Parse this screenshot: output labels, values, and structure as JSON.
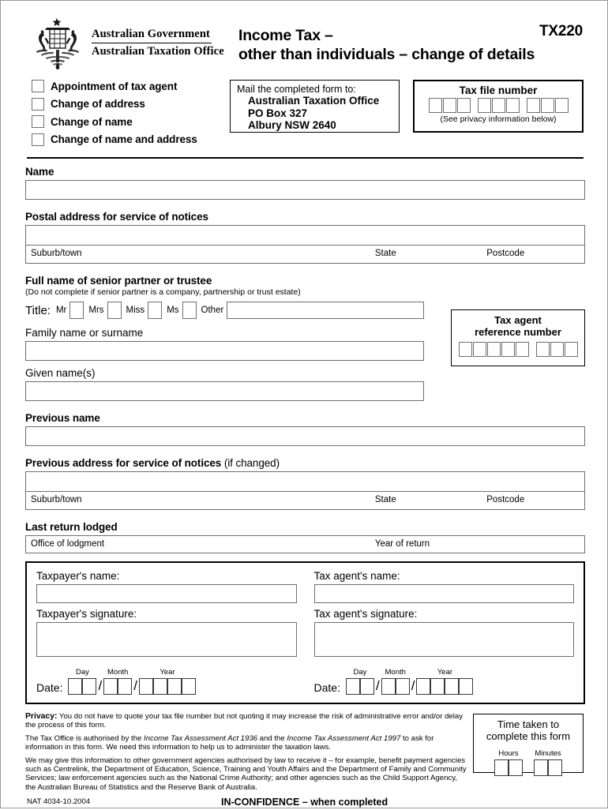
{
  "header": {
    "crest_icon": "australian-coat-of-arms-icon",
    "gov_line1": "Australian Government",
    "gov_line2": "Australian Taxation Office",
    "title_line1": "Income Tax –",
    "title_line2": "other than individuals – change of details",
    "form_code": "TX220"
  },
  "options": [
    {
      "label": "Appointment of tax agent"
    },
    {
      "label": "Change of address"
    },
    {
      "label": "Change of name"
    },
    {
      "label": "Change of name and address"
    }
  ],
  "mail_box": {
    "intro": "Mail the completed form to:",
    "line1": "Australian Taxation Office",
    "line2": "PO Box 327",
    "line3": "Albury NSW 2640"
  },
  "tfn_box": {
    "title": "Tax file number",
    "note": "(See privacy information below)",
    "groups": [
      3,
      3,
      3
    ]
  },
  "name_section": {
    "heading": "Name",
    "value": ""
  },
  "postal_address": {
    "heading": "Postal address for service of notices",
    "line1_value": "",
    "suburb_label": "Suburb/town",
    "state_label": "State",
    "postcode_label": "Postcode"
  },
  "senior_partner": {
    "heading": "Full name of senior partner or trustee",
    "subheading": "(Do not complete if senior partner is a company, partnership or trust estate)",
    "title_label": "Title:",
    "titles": [
      "Mr",
      "Mrs",
      "Miss",
      "Ms"
    ],
    "other_label": "Other",
    "other_value": "",
    "family_name_label": "Family name or surname",
    "family_name_value": "",
    "given_names_label": "Given name(s)",
    "given_names_value": ""
  },
  "agent_ref_box": {
    "title_line1": "Tax agent",
    "title_line2": "reference number",
    "groups": [
      5,
      3
    ]
  },
  "previous_name": {
    "heading": "Previous name",
    "value": ""
  },
  "previous_address": {
    "heading": "Previous address for service of notices",
    "heading_light": " (if changed)",
    "line1_value": "",
    "suburb_label": "Suburb/town",
    "state_label": "State",
    "postcode_label": "Postcode"
  },
  "last_return": {
    "heading": "Last return lodged",
    "office_label": "Office of lodgment",
    "year_label": "Year of return"
  },
  "declaration": {
    "taxpayer": {
      "name_label": "Taxpayer's name:",
      "name_value": "",
      "signature_label": "Taxpayer's signature:",
      "date_label": "Date:",
      "day_label": "Day",
      "month_label": "Month",
      "year_label": "Year"
    },
    "agent": {
      "name_label": "Tax agent's name:",
      "name_value": "",
      "signature_label": "Tax agent's signature:",
      "date_label": "Date:",
      "day_label": "Day",
      "month_label": "Month",
      "year_label": "Year"
    }
  },
  "privacy": {
    "lead": "Privacy:",
    "p1_rest": " You do not have to quote your tax file number but not quoting it may increase the risk of administrative error and/or delay the process of this form.",
    "p2_a": "The Tax Office is authorised by the ",
    "p2_act1": "Income Tax Assessment Act 1936",
    "p2_b": " and the ",
    "p2_act2": "Income Tax Assessment Act 1997",
    "p2_c": " to ask for information in this form. We need this information to help us to administer the taxation laws.",
    "p3": "We may give this information to other government agencies authorised by law to receive it – for example, benefit payment agencies such as Centrelink, the Department of Education, Science, Training and Youth Affairs and the Department of Family and Community Services; law enforcement agencies such as the National Crime Authority; and other agencies such as the Child Support Agency, the Australian Bureau of Statistics and the Reserve Bank of Australia."
  },
  "time_box": {
    "title_line1": "Time taken to",
    "title_line2": "complete this form",
    "hours_label": "Hours",
    "minutes_label": "Minutes"
  },
  "footer": {
    "nat": "NAT 4034-10.2004",
    "confidence": "IN-CONFIDENCE – when completed"
  }
}
